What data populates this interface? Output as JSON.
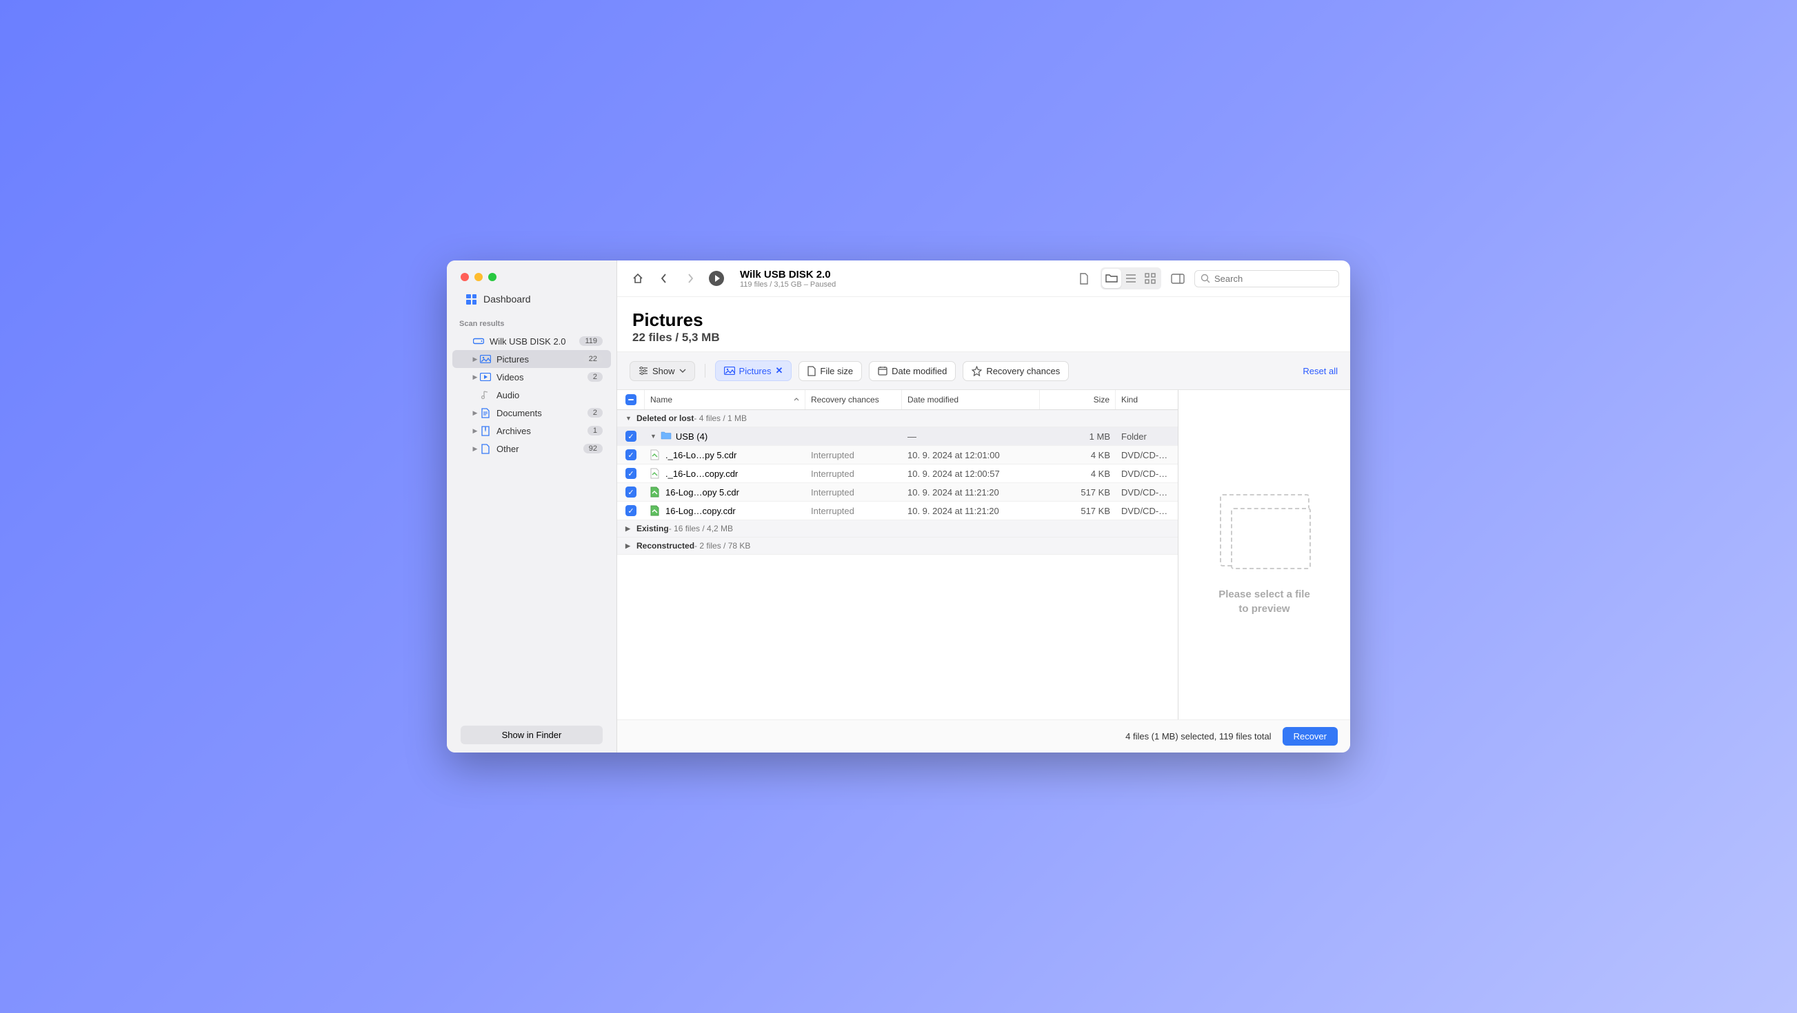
{
  "sidebar": {
    "dashboard": "Dashboard",
    "section_label": "Scan results",
    "disk": {
      "label": "Wilk USB DISK 2.0",
      "badge": "119"
    },
    "items": [
      {
        "label": "Pictures",
        "badge": "22",
        "active": true
      },
      {
        "label": "Videos",
        "badge": "2"
      },
      {
        "label": "Audio",
        "badge": ""
      },
      {
        "label": "Documents",
        "badge": "2"
      },
      {
        "label": "Archives",
        "badge": "1"
      },
      {
        "label": "Other",
        "badge": "92"
      }
    ],
    "show_in_finder": "Show in Finder"
  },
  "toolbar": {
    "title": "Wilk USB DISK 2.0",
    "subtitle": "119 files / 3,15 GB – Paused",
    "search_placeholder": "Search"
  },
  "heading": {
    "title": "Pictures",
    "subtitle": "22 files / 5,3 MB"
  },
  "filters": {
    "show": "Show",
    "pictures": "Pictures",
    "file_size": "File size",
    "date_modified": "Date modified",
    "recovery_chances": "Recovery chances",
    "reset": "Reset all"
  },
  "columns": {
    "name": "Name",
    "rc": "Recovery chances",
    "dm": "Date modified",
    "sz": "Size",
    "kd": "Kind"
  },
  "groups": {
    "deleted": {
      "label": "Deleted or lost",
      "meta": " - 4 files / 1 MB"
    },
    "existing": {
      "label": "Existing",
      "meta": " - 16 files / 4,2 MB"
    },
    "reconstructed": {
      "label": "Reconstructed",
      "meta": " - 2 files / 78 KB"
    }
  },
  "rows": [
    {
      "name": "USB (4)",
      "rc": "",
      "dm": "—",
      "sz": "1 MB",
      "kd": "Folder",
      "type": "folder"
    },
    {
      "name": "._16-Lo…py 5.cdr",
      "rc": "Interrupted",
      "dm": "10. 9. 2024 at 12:01:00",
      "sz": "4 KB",
      "kd": "DVD/CD-…",
      "type": "file-gray"
    },
    {
      "name": "._16-Lo…copy.cdr",
      "rc": "Interrupted",
      "dm": "10. 9. 2024 at 12:00:57",
      "sz": "4 KB",
      "kd": "DVD/CD-…",
      "type": "file-gray"
    },
    {
      "name": "16-Log…opy 5.cdr",
      "rc": "Interrupted",
      "dm": "10. 9. 2024 at 11:21:20",
      "sz": "517 KB",
      "kd": "DVD/CD-…",
      "type": "file-green"
    },
    {
      "name": "16-Log…copy.cdr",
      "rc": "Interrupted",
      "dm": "10. 9. 2024 at 11:21:20",
      "sz": "517 KB",
      "kd": "DVD/CD-…",
      "type": "file-green"
    }
  ],
  "preview": {
    "text1": "Please select a file",
    "text2": "to preview"
  },
  "footer": {
    "status": "4 files (1 MB) selected, 119 files total",
    "recover": "Recover"
  }
}
